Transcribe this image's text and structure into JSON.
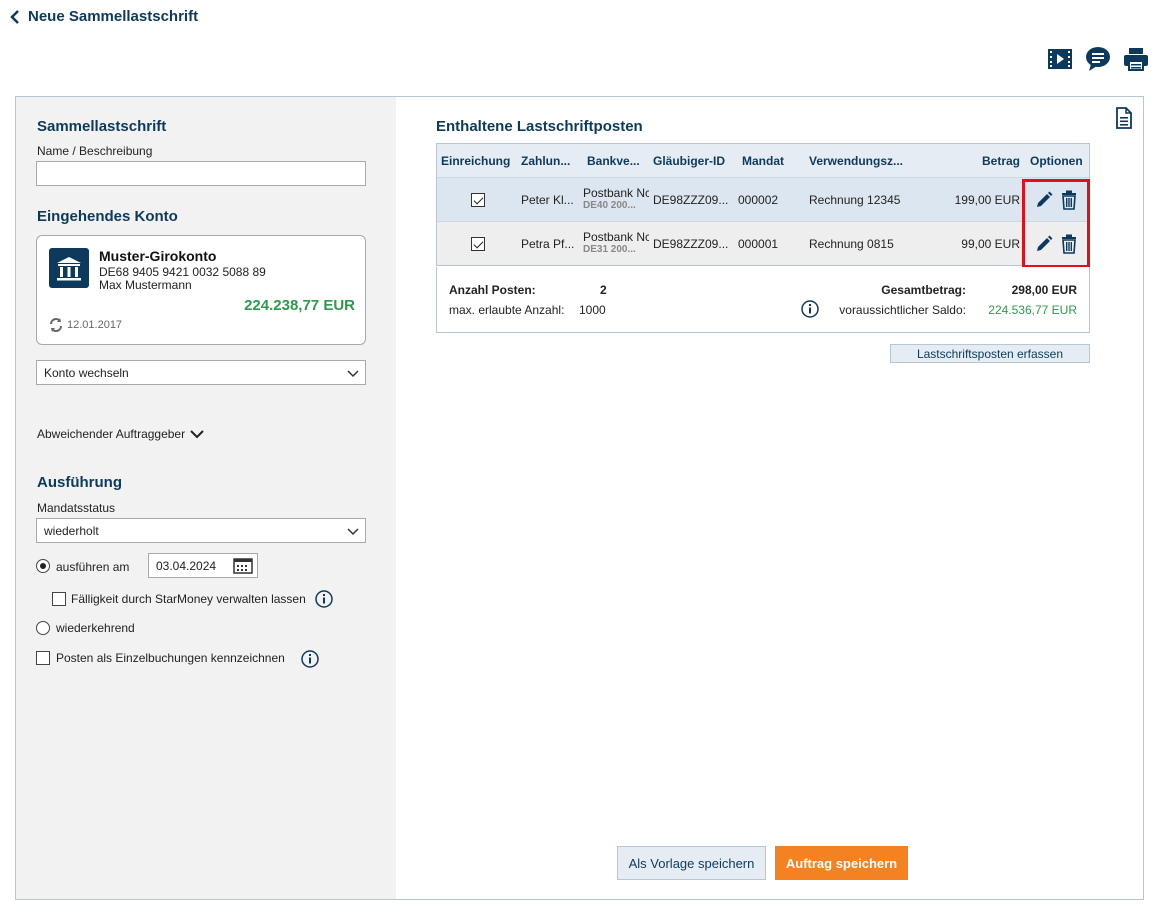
{
  "header": {
    "title": "Neue Sammellastschrift"
  },
  "toolbar": {
    "icons": [
      "video-icon",
      "chat-icon",
      "print-icon"
    ]
  },
  "left": {
    "section_title": "Sammellastschrift",
    "name_label": "Name / Beschreibung",
    "name_value": "",
    "account_section_title": "Eingehendes Konto",
    "account": {
      "name": "Muster-Girokonto",
      "iban": "DE68 9405 9421 0032 5088 89",
      "owner": "Max Mustermann",
      "balance": "224.238,77 EUR",
      "updated": "12.01.2017"
    },
    "switch_account": "Konto wechseln",
    "other_payer": "Abweichender Auftraggeber",
    "execution_title": "Ausführung",
    "mandate_label": "Mandatsstatus",
    "mandate_value": "wiederholt",
    "execute_on_label": "ausführen am",
    "execute_date": "03.04.2024",
    "due_label": "Fälligkeit durch StarMoney verwalten lassen",
    "recurring_label": "wiederkehrend",
    "single_booking_label": "Posten als Einzelbuchungen kennzeichnen"
  },
  "right": {
    "section_title": "Enthaltene Lastschriftposten",
    "columns": [
      "Einreichung",
      "Zahlun...",
      "Bankve...",
      "Gläubiger-ID",
      "Mandat",
      "Verwendungsz...",
      "Betrag",
      "Optionen"
    ],
    "rows": [
      {
        "payer": "Peter Kl...",
        "bank": "Postbank Nc",
        "iban": "DE40 200...",
        "creditor": "DE98ZZZ09...",
        "mandate": "000002",
        "purpose": "Rechnung 12345",
        "amount": "199,00 EUR",
        "checked": true
      },
      {
        "payer": "Petra Pf...",
        "bank": "Postbank Nc",
        "iban": "DE31 200...",
        "creditor": "DE98ZZZ09...",
        "mandate": "000001",
        "purpose": "Rechnung 0815",
        "amount": "99,00 EUR",
        "checked": true
      }
    ],
    "summary": {
      "count_label": "Anzahl Posten:",
      "count_value": "2",
      "max_label": "max. erlaubte Anzahl:",
      "max_value": "1000",
      "total_label": "Gesamtbetrag:",
      "total_value": "298,00 EUR",
      "saldo_label": "voraussichtlicher Saldo:",
      "saldo_value": "224.536,77 EUR"
    },
    "add_item": "Lastschriftsposten erfassen",
    "save_template": "Als Vorlage speichern",
    "save_order": "Auftrag speichern"
  },
  "colors": {
    "brand": "#0d3a5c",
    "positive": "#2e9b4c",
    "primary_button": "#f58220",
    "highlight": "#e0101a"
  }
}
